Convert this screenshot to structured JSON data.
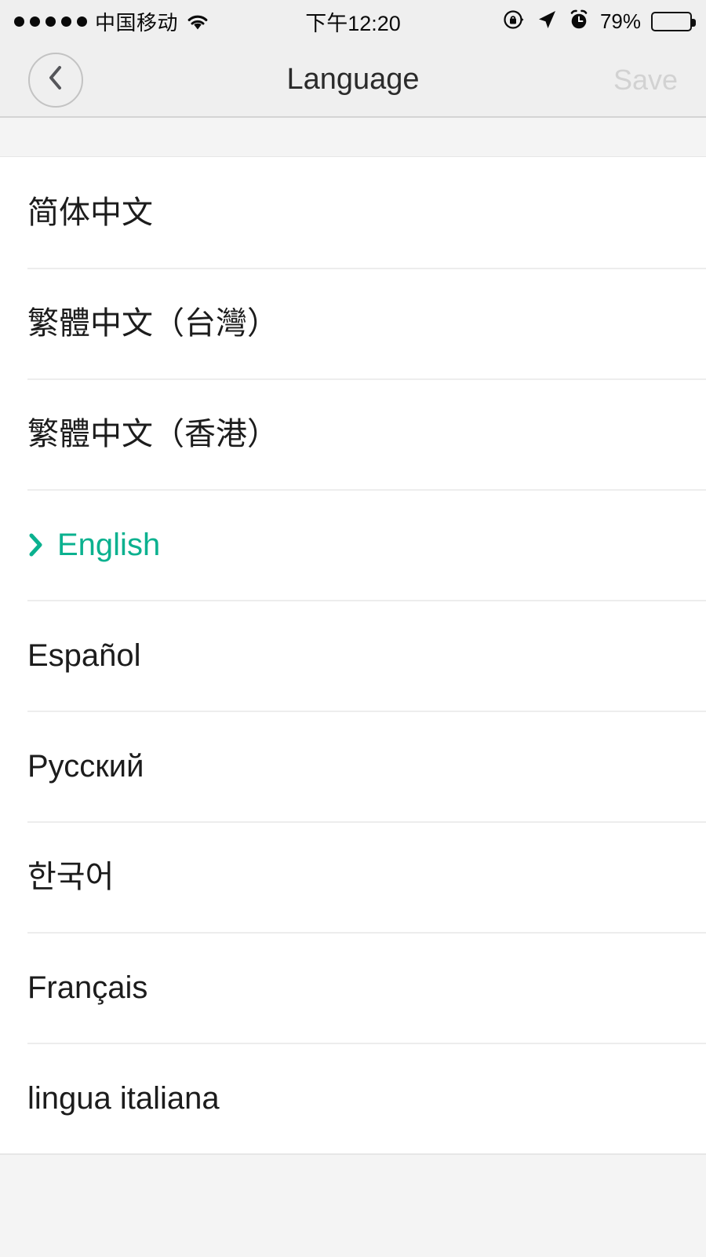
{
  "status_bar": {
    "signal_dots": 5,
    "carrier": "中国移动",
    "wifi_icon": "wifi-icon",
    "time": "下午12:20",
    "rotation_lock_icon": "rotation-lock-icon",
    "location_icon": "location-arrow-icon",
    "alarm_icon": "alarm-clock-icon",
    "battery_percent": "79%",
    "battery_level": 79
  },
  "nav_bar": {
    "back_icon": "chevron-left-icon",
    "title": "Language",
    "save_label": "Save",
    "save_enabled": false
  },
  "colors": {
    "accent": "#0bb18f",
    "nav_background": "#efefef",
    "page_background": "#f4f4f4",
    "list_background": "#ffffff",
    "text": "#1c1c1c",
    "separator": "#ededed",
    "disabled_text": "#d2d2d2"
  },
  "list": {
    "selected_index": 3,
    "selected_marker_icon": "chevron-right-icon",
    "items": [
      {
        "label": "简体中文",
        "selected": false
      },
      {
        "label": "繁體中文（台灣）",
        "selected": false
      },
      {
        "label": "繁體中文（香港）",
        "selected": false
      },
      {
        "label": "English",
        "selected": true
      },
      {
        "label": "Español",
        "selected": false
      },
      {
        "label": "Русский",
        "selected": false
      },
      {
        "label": "한국어",
        "selected": false
      },
      {
        "label": "Français",
        "selected": false
      },
      {
        "label": "lingua italiana",
        "selected": false
      }
    ]
  }
}
